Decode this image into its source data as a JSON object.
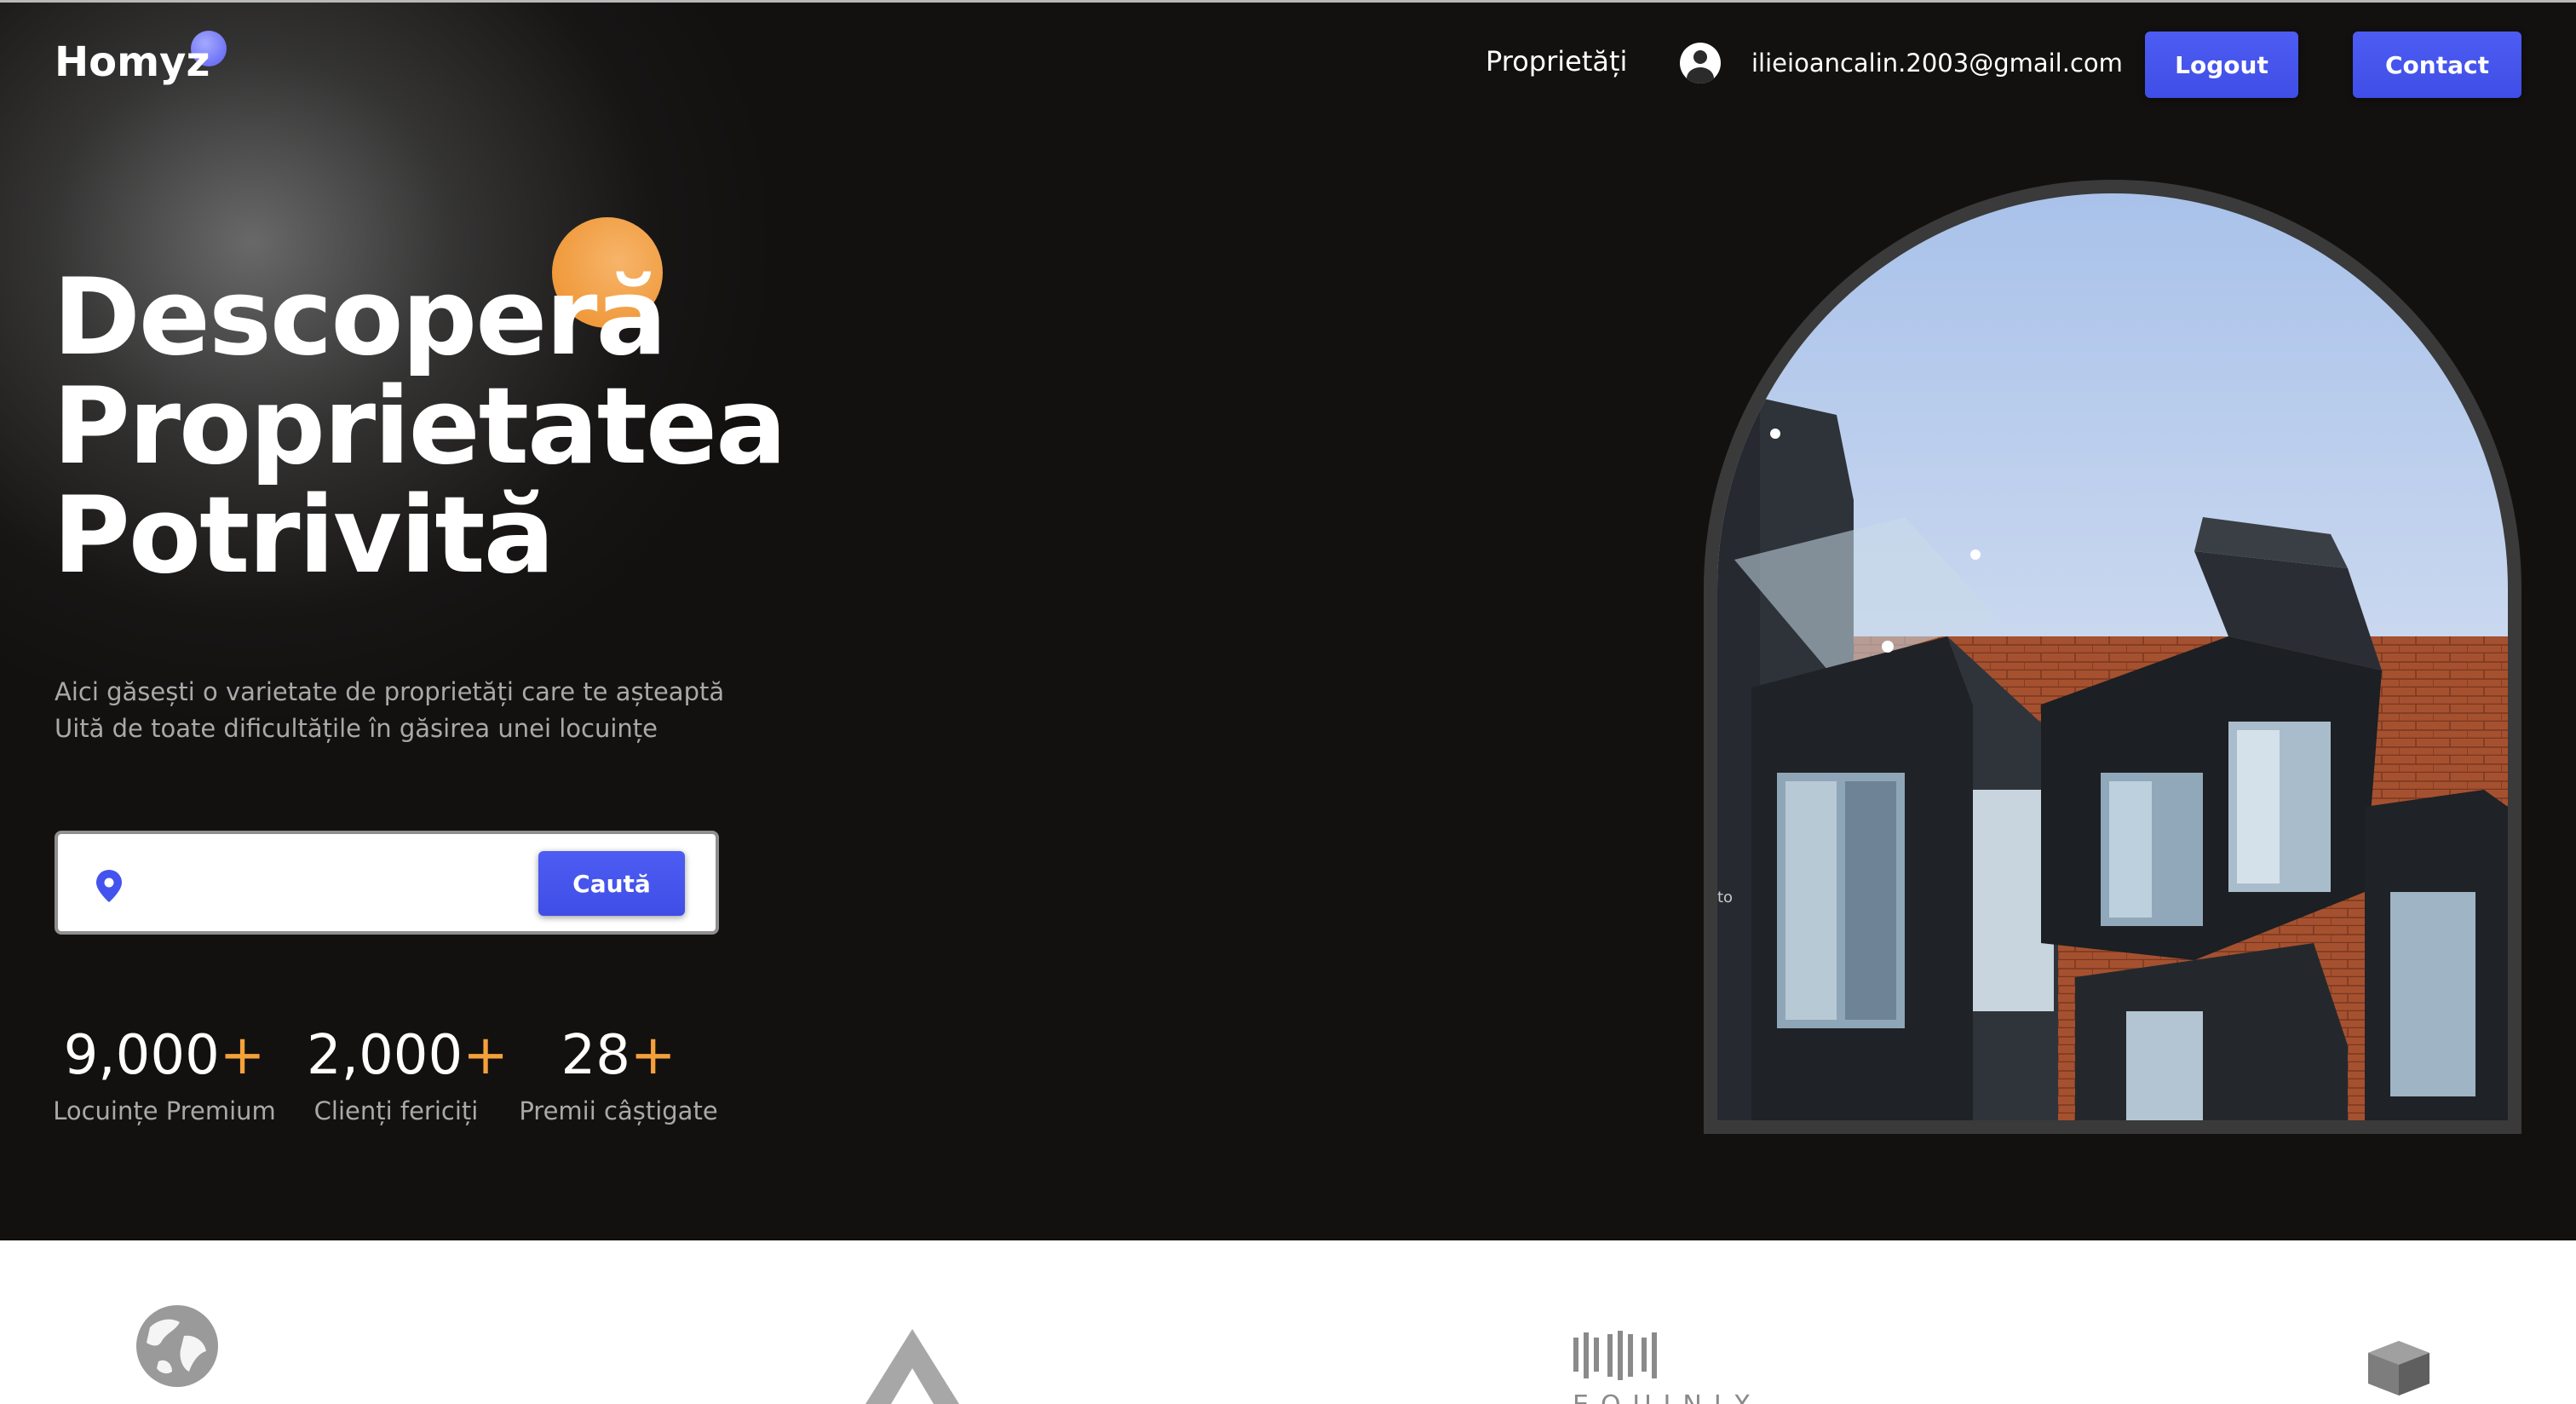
{
  "header": {
    "logo_text": "Homyz",
    "nav_link": "Proprietăți",
    "user_email": "ilieioancalin.2003@gmail.com",
    "logout_label": "Logout",
    "contact_label": "Contact"
  },
  "hero": {
    "title_line_1": "Descoperă",
    "title_line_2": "Proprietatea",
    "title_line_3": "Potrivită",
    "description_line_1": "Aici găsești o varietate de proprietăți care te așteaptă",
    "description_line_2": "Uită de toate dificultățile în găsirea unei locuințe",
    "image_alt": "to"
  },
  "search": {
    "value": "",
    "button_label": "Caută"
  },
  "stats": [
    {
      "number": "9,000",
      "suffix": "+",
      "label": "Locuințe Premium"
    },
    {
      "number": "2,000",
      "suffix": "+",
      "label": "Clienți fericiți"
    },
    {
      "number": "28",
      "suffix": "+",
      "label": "Premii câștigate"
    }
  ],
  "partners": {
    "equinix_label": "EQUINIX"
  },
  "colors": {
    "background": "#131110",
    "accent_blue": "#4453ee",
    "accent_orange": "#f5a13a",
    "muted_text": "#a9a9a9"
  },
  "icons": [
    "user-icon",
    "location-pin-icon",
    "globe-logo",
    "triangle-logo",
    "equinix-logo",
    "cube-logo"
  ]
}
